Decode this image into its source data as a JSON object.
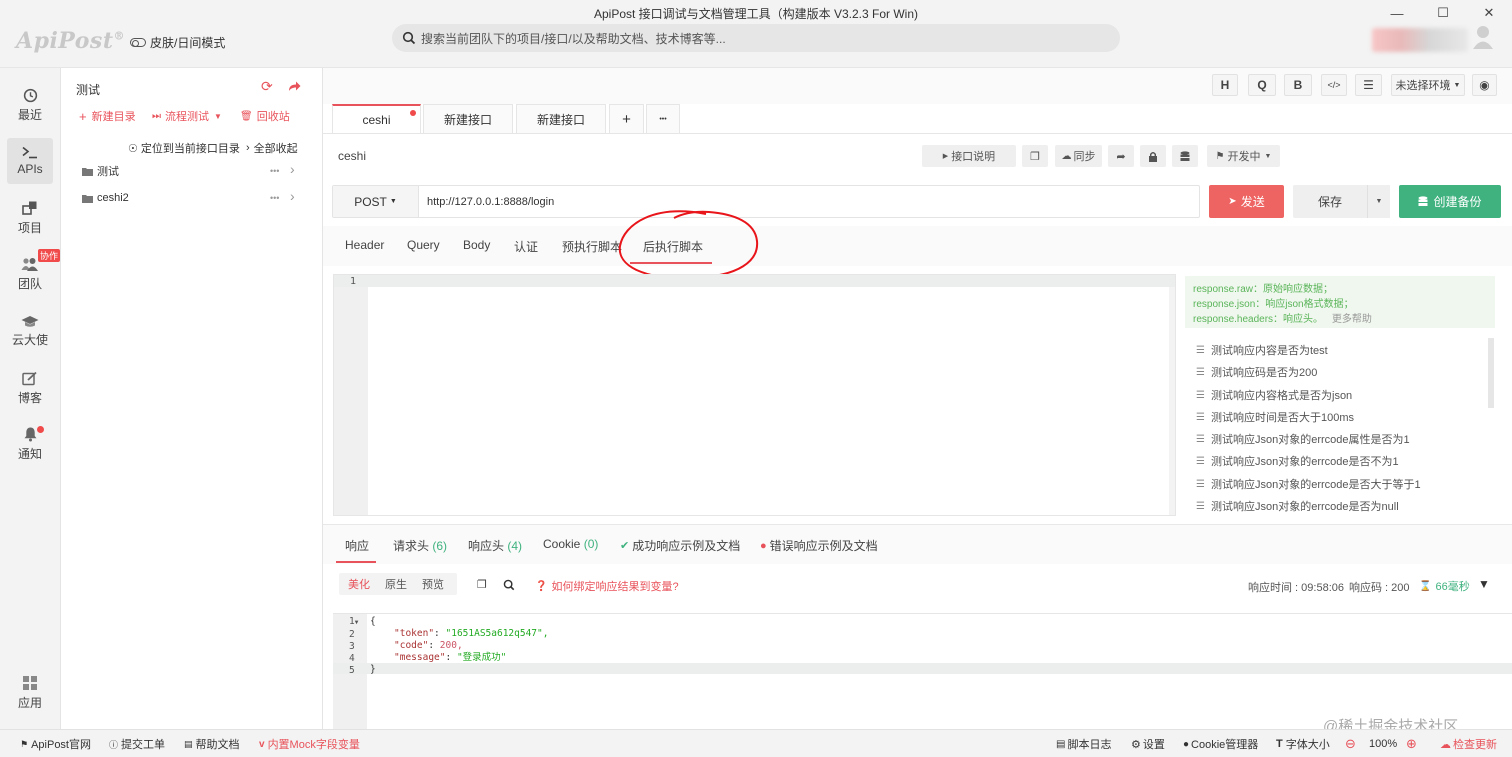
{
  "window": {
    "title": "ApiPost 接口调试与文档管理工具（构建版本 V3.2.3 For Win)"
  },
  "header": {
    "logo": "ApiPost",
    "logo_mark": "®",
    "skin_mode": "皮肤/日间模式",
    "search_placeholder": "搜索当前团队下的项目/接口/以及帮助文档、技术博客等..."
  },
  "nav": {
    "items": [
      {
        "label": "最近",
        "icon": "clock-icon"
      },
      {
        "label": "APIs",
        "icon": "terminal-icon"
      },
      {
        "label": "项目",
        "icon": "project-icon"
      },
      {
        "label": "团队",
        "icon": "team-icon",
        "badge": "协作"
      },
      {
        "label": "云大使",
        "icon": "graduation-cap-icon"
      },
      {
        "label": "博客",
        "icon": "edit-icon"
      },
      {
        "label": "通知",
        "icon": "bell-icon"
      },
      {
        "label": "应用",
        "icon": "grid-icon"
      }
    ]
  },
  "tree": {
    "title": "测试",
    "new_dir": "新建目录",
    "flow_test": "流程测试",
    "recycle": "回收站",
    "locate": "定位到当前接口目录",
    "collapse_all": "全部收起",
    "folders": [
      {
        "name": "测试"
      },
      {
        "name": "ceshi2"
      }
    ]
  },
  "toolbar": {
    "h": "H",
    "q": "Q",
    "b": "B",
    "code": "</>",
    "env": "未选择环境"
  },
  "tabs": [
    {
      "label": "ceshi",
      "active": true
    },
    {
      "label": "新建接口"
    },
    {
      "label": "新建接口"
    }
  ],
  "tab_add": "+",
  "tab_more": "•••",
  "request": {
    "name": "ceshi",
    "doc_btn": "接口说明",
    "sync_btn": "同步",
    "status": "开发中",
    "method": "POST",
    "url": "http://127.0.0.1:8888/login",
    "send": "发送",
    "save": "保存",
    "backup": "创建备份"
  },
  "req_tabs": [
    "Header",
    "Query",
    "Body",
    "认证",
    "预执行脚本",
    "后执行脚本"
  ],
  "editor": {
    "line": "1"
  },
  "help": {
    "raw": "response.raw：原始响应数据；",
    "json": "response.json：响应json格式数据；",
    "headers": "response.headers：响应头。",
    "more": "更多帮助",
    "items": [
      "测试响应内容是否为test",
      "测试响应码是否为200",
      "测试响应内容格式是否为json",
      "测试响应时间是否大于100ms",
      "测试响应Json对象的errcode属性是否为1",
      "测试响应Json对象的errcode是否不为1",
      "测试响应Json对象的errcode是否大于等于1",
      "测试响应Json对象的errcode是否为null"
    ]
  },
  "resp_tabs": {
    "resp": "响应",
    "req_headers": "请求头",
    "req_headers_count": "(6)",
    "resp_headers": "响应头",
    "resp_headers_count": "(4)",
    "cookie": "Cookie",
    "cookie_count": "(0)",
    "success_example": "成功响应示例及文档",
    "error_example": "错误响应示例及文档"
  },
  "resp_view": {
    "pretty": "美化",
    "raw": "原生",
    "preview": "预览",
    "bind_tip": "如何绑定响应结果到变量?",
    "time_label": "响应时间 : 09:58:06",
    "code_label": "响应码 : 200",
    "duration": "66毫秒"
  },
  "resp_body": {
    "lines": [
      {
        "n": "1",
        "text": "{"
      },
      {
        "n": "2",
        "key": "\"token\"",
        "val": "\"1651AS5a612q547\","
      },
      {
        "n": "3",
        "key": "\"code\"",
        "val": "200,"
      },
      {
        "n": "4",
        "key": "\"message\"",
        "val": "\"登录成功\""
      },
      {
        "n": "5",
        "text": "}"
      }
    ]
  },
  "status": {
    "site": "ApiPost官网",
    "ticket": "提交工单",
    "help": "帮助文档",
    "mock": "内置Mock字段变量",
    "log": "脚本日志",
    "settings": "设置",
    "cookie": "Cookie管理器",
    "font": "字体大小",
    "zoom": "100%",
    "update": "检查更新",
    "watermark": "@稀土掘金技术社区"
  },
  "colors": {
    "accent": "#e8535b",
    "green": "#3fb27f",
    "help_green": "#5ab55a"
  }
}
